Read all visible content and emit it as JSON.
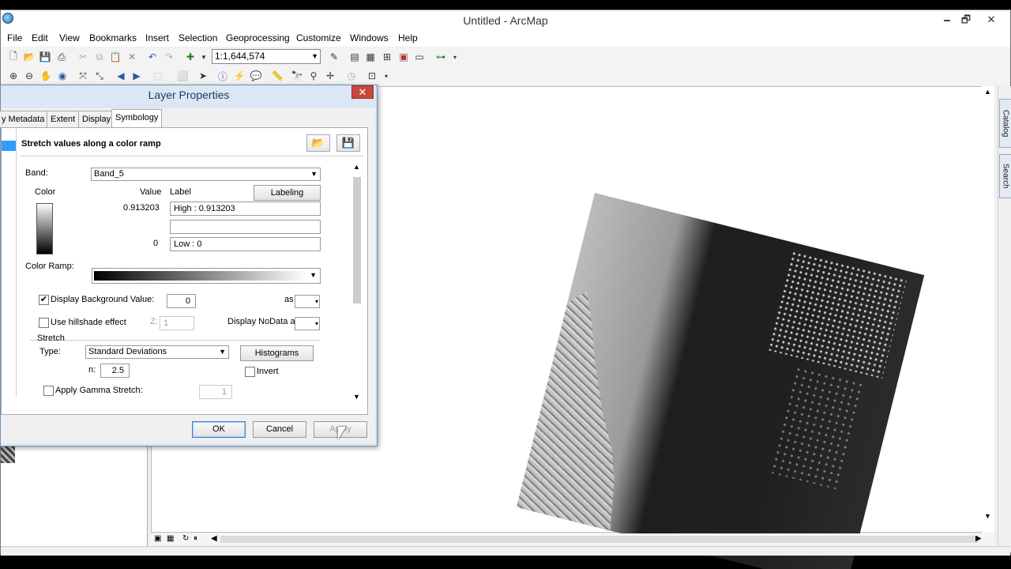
{
  "app": {
    "title": "Untitled - ArcMap",
    "win_min": "🗕",
    "win_max": "🗗",
    "win_close": "✕"
  },
  "menu": [
    "File",
    "Edit",
    "View",
    "Bookmarks",
    "Insert",
    "Selection",
    "Geoprocessing",
    "Customize",
    "Windows",
    "Help"
  ],
  "toolbar": {
    "scale_value": "1:1,644,574"
  },
  "sidebar": {
    "catalog_label": "Catalog",
    "search_label": "Search"
  },
  "dialog": {
    "title": "Layer Properties",
    "close": "✕",
    "tabs": [
      "y Metadata",
      "Extent",
      "Display",
      "Symbology"
    ],
    "active_tab": "Symbology",
    "heading": "Stretch values along a color ramp",
    "band_label": "Band:",
    "band_value": "Band_5",
    "color_header": "Color",
    "value_header": "Value",
    "label_header": "Label",
    "labeling_button": "Labeling",
    "high_value": "0.913203",
    "high_label": "High : 0.913203",
    "low_value": "0",
    "low_label": "Low : 0",
    "color_ramp_label": "Color Ramp:",
    "display_bg_label": "Display Background Value:",
    "display_bg_checked": "✔",
    "bg_value": "0",
    "as_label": "as",
    "hillshade_label": "Use hillshade effect",
    "z_label": "Z:",
    "z_value": "1",
    "nodata_label": "Display NoData as",
    "stretch_label": "Stretch",
    "type_label": "Type:",
    "type_value": "Standard Deviations",
    "histograms_button": "Histograms",
    "n_label": "n:",
    "n_value": "2.5",
    "invert_label": "Invert",
    "gamma_label": "Apply Gamma Stretch:",
    "gamma_value": "1",
    "ok": "OK",
    "cancel": "Cancel",
    "apply": "Apply"
  }
}
